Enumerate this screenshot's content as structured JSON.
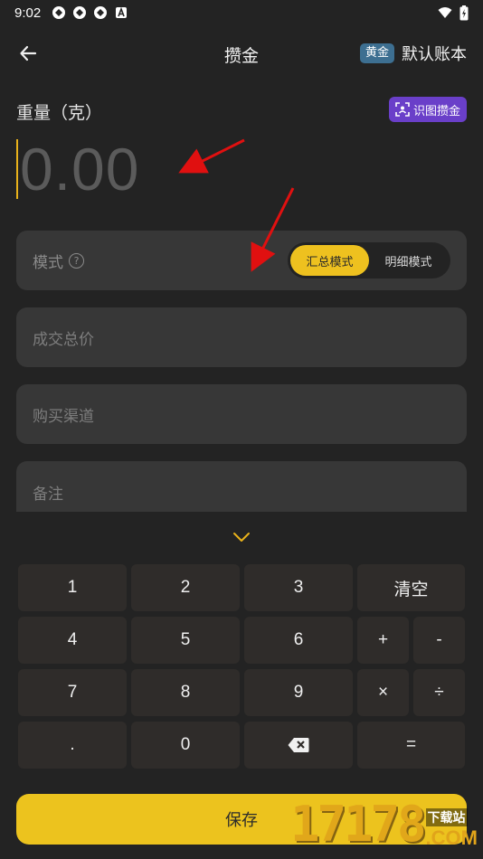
{
  "status_bar": {
    "time": "9:02"
  },
  "app_bar": {
    "title": "攒金",
    "ledger_badge": "黄金",
    "ledger_name": "默认账本"
  },
  "weight": {
    "label": "重量（克）",
    "recognize_button": "识图攒金",
    "amount": "0.00"
  },
  "fields": {
    "mode_label": "模式",
    "mode_options": [
      "汇总模式",
      "明细模式"
    ],
    "mode_selected": "汇总模式",
    "total_price_placeholder": "成交总价",
    "channel_placeholder": "购买渠道",
    "note_placeholder": "备注"
  },
  "keypad": {
    "keys": [
      "1",
      "2",
      "3",
      "清空",
      "4",
      "5",
      "6",
      "+",
      "-",
      "7",
      "8",
      "9",
      "×",
      "÷",
      ".",
      "0",
      "⌫",
      "="
    ]
  },
  "save_button": "保存",
  "watermark": {
    "number": "17178",
    "text": "下载站",
    "suffix": ".COM"
  },
  "colors": {
    "accent": "#ecc31e",
    "badge": "#3d6f91",
    "recognize": "#6a3fc9",
    "annotation_arrow": "#e01010"
  }
}
